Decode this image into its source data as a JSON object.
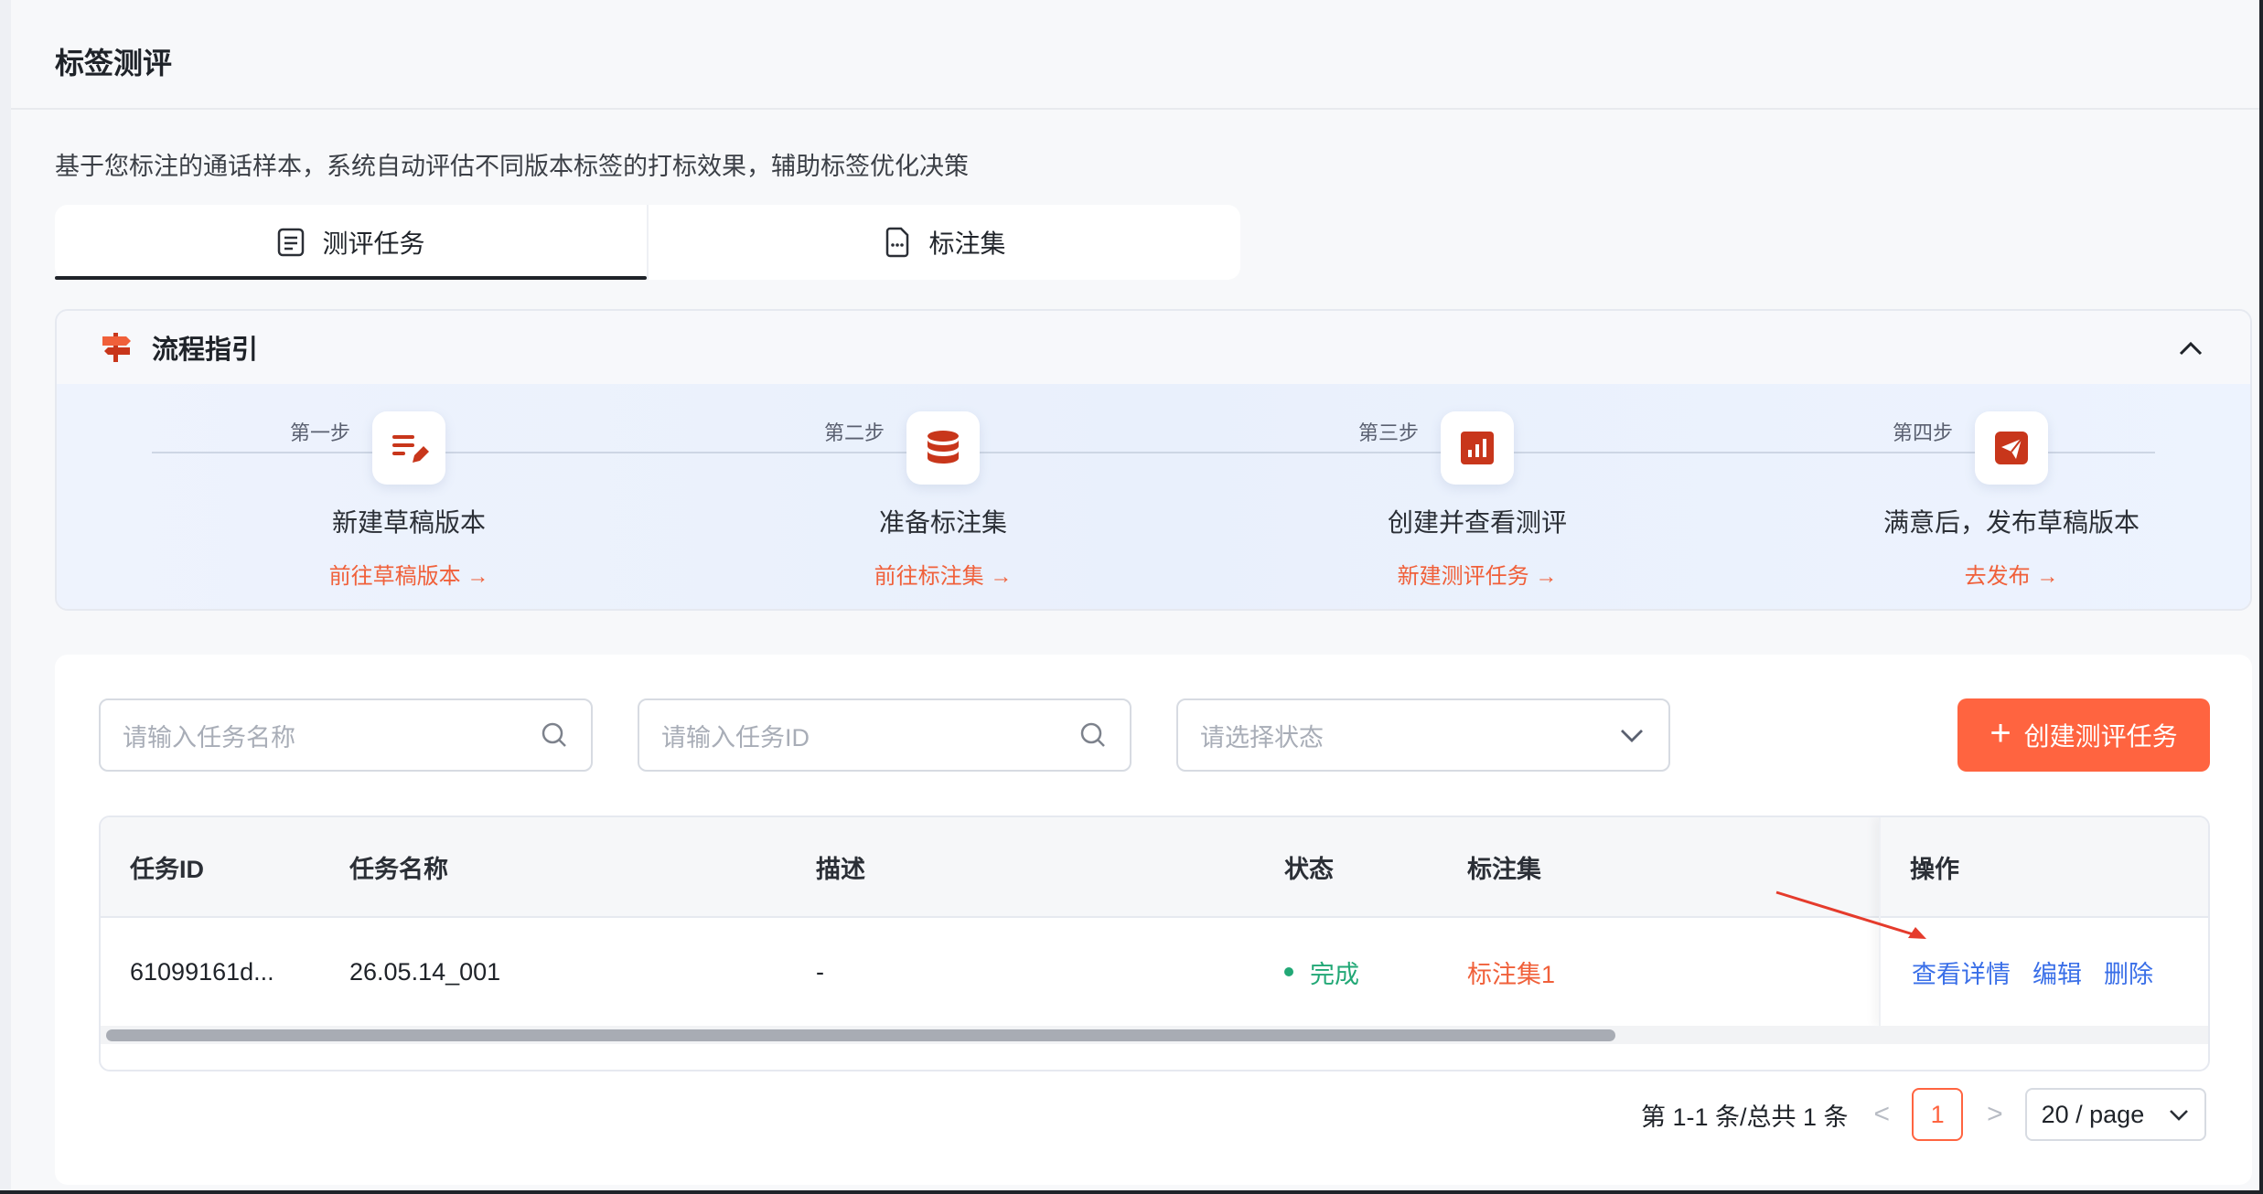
{
  "page": {
    "title": "标签测评",
    "subtitle": "基于您标注的通话样本，系统自动评估不同版本标签的打标效果，辅助标签优化决策"
  },
  "tabs": [
    {
      "label": "测评任务",
      "icon": "list-doc-icon",
      "active": true
    },
    {
      "label": "标注集",
      "icon": "file-dots-icon",
      "active": false
    }
  ],
  "guide": {
    "title": "流程指引",
    "icon": "signpost-icon",
    "steps": [
      {
        "label": "第一步",
        "name": "新建草稿版本",
        "link": "前往草稿版本 →",
        "icon": "edit-list-icon"
      },
      {
        "label": "第二步",
        "name": "准备标注集",
        "link": "前往标注集 →",
        "icon": "database-icon"
      },
      {
        "label": "第三步",
        "name": "创建并查看测评",
        "link": "新建测评任务 →",
        "icon": "bar-chart-icon"
      },
      {
        "label": "第四步",
        "name": "满意后，发布草稿版本",
        "link": "去发布 →",
        "icon": "send-icon"
      }
    ]
  },
  "filters": {
    "task_name_placeholder": "请输入任务名称",
    "task_id_placeholder": "请输入任务ID",
    "status_placeholder": "请选择状态",
    "create_button": "创建测评任务",
    "create_icon": "+"
  },
  "table": {
    "headers": {
      "id": "任务ID",
      "name": "任务名称",
      "desc": "描述",
      "status": "状态",
      "dataset": "标注集",
      "ops": "操作"
    },
    "rows": [
      {
        "id": "61099161d...",
        "name": "26.05.14_001",
        "desc": "-",
        "status": "完成",
        "dataset": "标注集1",
        "actions": {
          "view": "查看详情",
          "edit": "编辑",
          "delete": "删除"
        }
      }
    ]
  },
  "pagination": {
    "summary": "第 1-1 条/总共 1 条",
    "prev": "<",
    "current_page": "1",
    "next": ">",
    "page_size": "20 / page"
  },
  "colors": {
    "accent": "#ff6440",
    "link": "#3a6fe8",
    "success": "#22a876",
    "icon_red": "#c8361b"
  }
}
